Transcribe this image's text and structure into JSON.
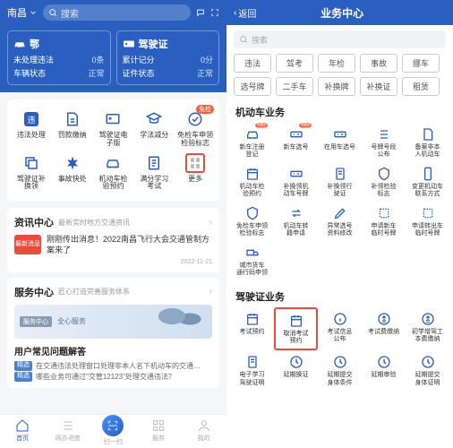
{
  "left": {
    "city": "南昌",
    "search": "搜索",
    "card1": {
      "title": "鄂",
      "r1k": "未处理违法",
      "r1v": "0条",
      "r2k": "车辆状态",
      "r2v": "正常"
    },
    "card2": {
      "title": "驾驶证",
      "r1k": "累计记分",
      "r1v": "0分",
      "r2k": "证件状态",
      "r2v": "正常"
    },
    "grid": [
      {
        "label": "违法处理",
        "icon": "sq",
        "txt": "违"
      },
      {
        "label": "罚款缴纳",
        "icon": "fine"
      },
      {
        "label": "驾驶证电\n子版",
        "icon": "lic"
      },
      {
        "label": "学法减分",
        "icon": "study"
      },
      {
        "label": "免检车申领\n检验标志",
        "icon": "check",
        "badge": "免检"
      },
      {
        "label": "驾驶证补\n换领",
        "icon": "replace"
      },
      {
        "label": "事故快处",
        "icon": "accident"
      },
      {
        "label": "机动车检\n验预约",
        "icon": "car"
      },
      {
        "label": "满分学习\n考试",
        "icon": "full"
      },
      {
        "label": "更多",
        "icon": "more",
        "highlight": true
      }
    ],
    "info": {
      "title": "资讯中心",
      "sub": "最新实时地方交通资讯",
      "badge": "最新消息",
      "text": "刚刚传出消息！2022南昌飞行大会交通管制方案来了",
      "date": "2022-11-21"
    },
    "svc": {
      "title": "服务中心",
      "sub": "匠心打造完善服务体系",
      "tag": "服务中心",
      "txt": "全心服务"
    },
    "faq": {
      "title": "用户常见问题解答",
      "q1": "在交通违法处理窗口处理非本人名下机动车的交通…",
      "q2": "哪些业务可通过\"交管12123\"处理交通违法？",
      "tag": "精选"
    },
    "tabs": [
      "首页",
      "网办进度",
      "扫一扫",
      "服务",
      "我的"
    ]
  },
  "right": {
    "back": "返回",
    "title": "业务中心",
    "search": "搜索",
    "chips": [
      "违法",
      "驾考",
      "年检",
      "事故",
      "挪车",
      "选号牌",
      "二手车",
      "补换牌",
      "补换证",
      "租赁"
    ],
    "sec1": "机动车业务",
    "g1": [
      {
        "l": "新车注册\n登记",
        "i": "car",
        "b": "New"
      },
      {
        "l": "新车选号",
        "i": "plate",
        "b": "New"
      },
      {
        "l": "在用车选号",
        "i": "plate"
      },
      {
        "l": "号牌号段\n公布",
        "i": "list"
      },
      {
        "l": "备案非本\n人机动车",
        "i": "file"
      },
      {
        "l": "机动车检\n验预约",
        "i": "cal"
      },
      {
        "l": "补换领机\n动车号牌",
        "i": "plate"
      },
      {
        "l": "补换领行\n驶证",
        "i": "doc"
      },
      {
        "l": "补领检验\n标志",
        "i": "badge"
      },
      {
        "l": "变更机动车\n联系方式",
        "i": "phone"
      },
      {
        "l": "免检车申领\n检验标志",
        "i": "badge"
      },
      {
        "l": "机动车转\n籍申请",
        "i": "transfer"
      },
      {
        "l": "异常选号\n资料修改",
        "i": "edit"
      },
      {
        "l": "申请新车\n临时号牌",
        "i": "temp"
      },
      {
        "l": "申请转出车\n临时号牌",
        "i": "temp"
      },
      {
        "l": "城市货车\n通行码申领",
        "i": "truck"
      }
    ],
    "sec2": "驾驶证业务",
    "g2": [
      {
        "l": "考试预约",
        "i": "cal"
      },
      {
        "l": "取消考试\n预约",
        "i": "cal",
        "hl": true
      },
      {
        "l": "考试信息\n公布",
        "i": "info"
      },
      {
        "l": "考试费缴纳",
        "i": "pay"
      },
      {
        "l": "初学增驾工\n本费缴纳",
        "i": "pay"
      },
      {
        "l": "电子学习\n驾驶证明",
        "i": "doc"
      },
      {
        "l": "延期换证",
        "i": "ext"
      },
      {
        "l": "延期提交\n身体条件",
        "i": "ext"
      },
      {
        "l": "延期审验",
        "i": "ext"
      },
      {
        "l": "延期提交\n身体证明",
        "i": "ext"
      }
    ]
  }
}
